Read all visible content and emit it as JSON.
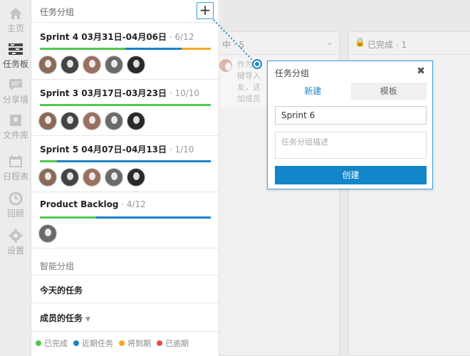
{
  "colors": {
    "done": "#4fc84f",
    "upcoming": "#1a82c8",
    "due_soon": "#f5a623",
    "overdue": "#e84b4b",
    "primary": "#1385c9"
  },
  "rail": {
    "items": [
      {
        "label": "主页",
        "icon": "home-icon"
      },
      {
        "label": "任务板",
        "icon": "board-icon"
      },
      {
        "label": "分享墙",
        "icon": "chat-icon"
      },
      {
        "label": "文件库",
        "icon": "file-icon"
      },
      {
        "label": "日程表",
        "icon": "calendar-icon"
      },
      {
        "label": "回顾",
        "icon": "history-icon"
      },
      {
        "label": "设置",
        "icon": "gear-icon"
      }
    ]
  },
  "panel": {
    "title": "任务分组",
    "add_label": "+",
    "groups": [
      {
        "name": "Sprint 4 03月31日-04月06日",
        "count": " · 6/12",
        "progress": {
          "done": 0.5,
          "upcoming": 0.33,
          "due_soon": 0.17
        }
      },
      {
        "name": "Sprint 3 03月17日-03月23日",
        "count": " · 10/10",
        "progress": {
          "done": 1.0
        }
      },
      {
        "name": "Sprint 5 04月07日-04月13日",
        "count": " · 1/10",
        "progress": {
          "done": 0.1,
          "upcoming": 0.9
        }
      },
      {
        "name": "Product Backlog",
        "count": " · 4/12",
        "progress": {
          "done": 0.33,
          "upcoming": 0.67
        }
      }
    ],
    "smart_label": "智能分组",
    "today_label": "今天的任务",
    "member_label": "成员的任务",
    "legend": {
      "done": "已完成",
      "upcoming": "近期任务",
      "due_soon": "将到期",
      "overdue": "已逾期"
    }
  },
  "board": {
    "col1_head": "中 · 5",
    "col1_text": [
      "作为",
      "键导入",
      "友，这",
      "加成员"
    ],
    "col2_head": "已完成 · 1"
  },
  "popover": {
    "title": "任务分组",
    "tab_new": "新建",
    "tab_template": "模板",
    "name_value": "Sprint 6",
    "desc_placeholder": "任务分组描述",
    "create_label": "创建"
  }
}
